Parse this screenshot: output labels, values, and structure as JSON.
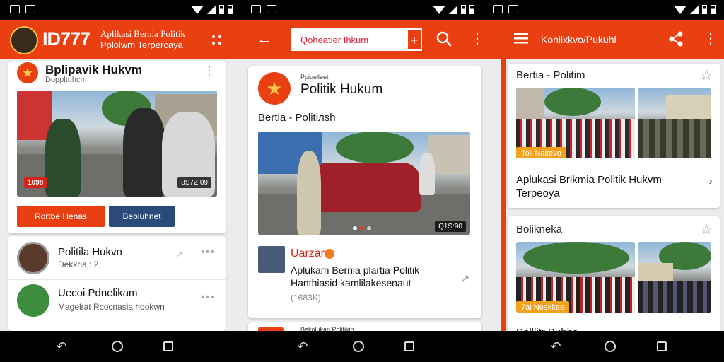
{
  "status": {
    "icons": [
      "image-icon",
      "cast-icon",
      "wifi-icon",
      "signal-icon",
      "battery-icon"
    ]
  },
  "s1": {
    "brand": "ID777",
    "tagline1": "Aplikasi Bernia Politik",
    "tagline2": "Pplolwm Terpercaya",
    "card_title": "Bplipavik Hukvm",
    "card_subtitle": "Doppltuhcm",
    "img_badge_left": "1698",
    "img_badge_right": "8S7Z.09",
    "btn_primary": "Rortbe Henas",
    "btn_secondary": "Bebluhnet",
    "list": [
      {
        "title": "Politila Hukvn",
        "sub": "Dekkria : 2"
      },
      {
        "title": "Uecoi Pdnelikam",
        "sub": "Magelrat Rcocnasia hookwn"
      }
    ]
  },
  "s2": {
    "search_value": "Qoheatier Ihkum",
    "card_small": "Ppioelleet",
    "card_title": "Politik Hukum",
    "section": "Bertia - Politiлsh",
    "img_badge": "Q1S:90",
    "list_name": "Uarzar",
    "list_title1": "Aplukam Bernia plartia Politik",
    "list_title2": "Hanthiasid kamlilakesenaut",
    "list_meta": "(1683K)",
    "next_title": "Bekolukan Politikin"
  },
  "s3": {
    "appbar_title": "Koniixkvo/Pukuhl",
    "sec1": "Bertia - Politim",
    "sec1_badge": "Toil Nakevo",
    "sec1_title1": "Aplukasi Brlkmia Politik Hukvm",
    "sec1_title2": "Terpeoya",
    "sec2": "Bolikneka",
    "sec2_badge": "7al Neakkee",
    "sec2_bottom": "Palllitr Bubbs"
  },
  "colors": {
    "brand": "#ea3f10",
    "navy": "#2a4a7a",
    "orange": "#f5a11c",
    "red": "#d6261a"
  }
}
